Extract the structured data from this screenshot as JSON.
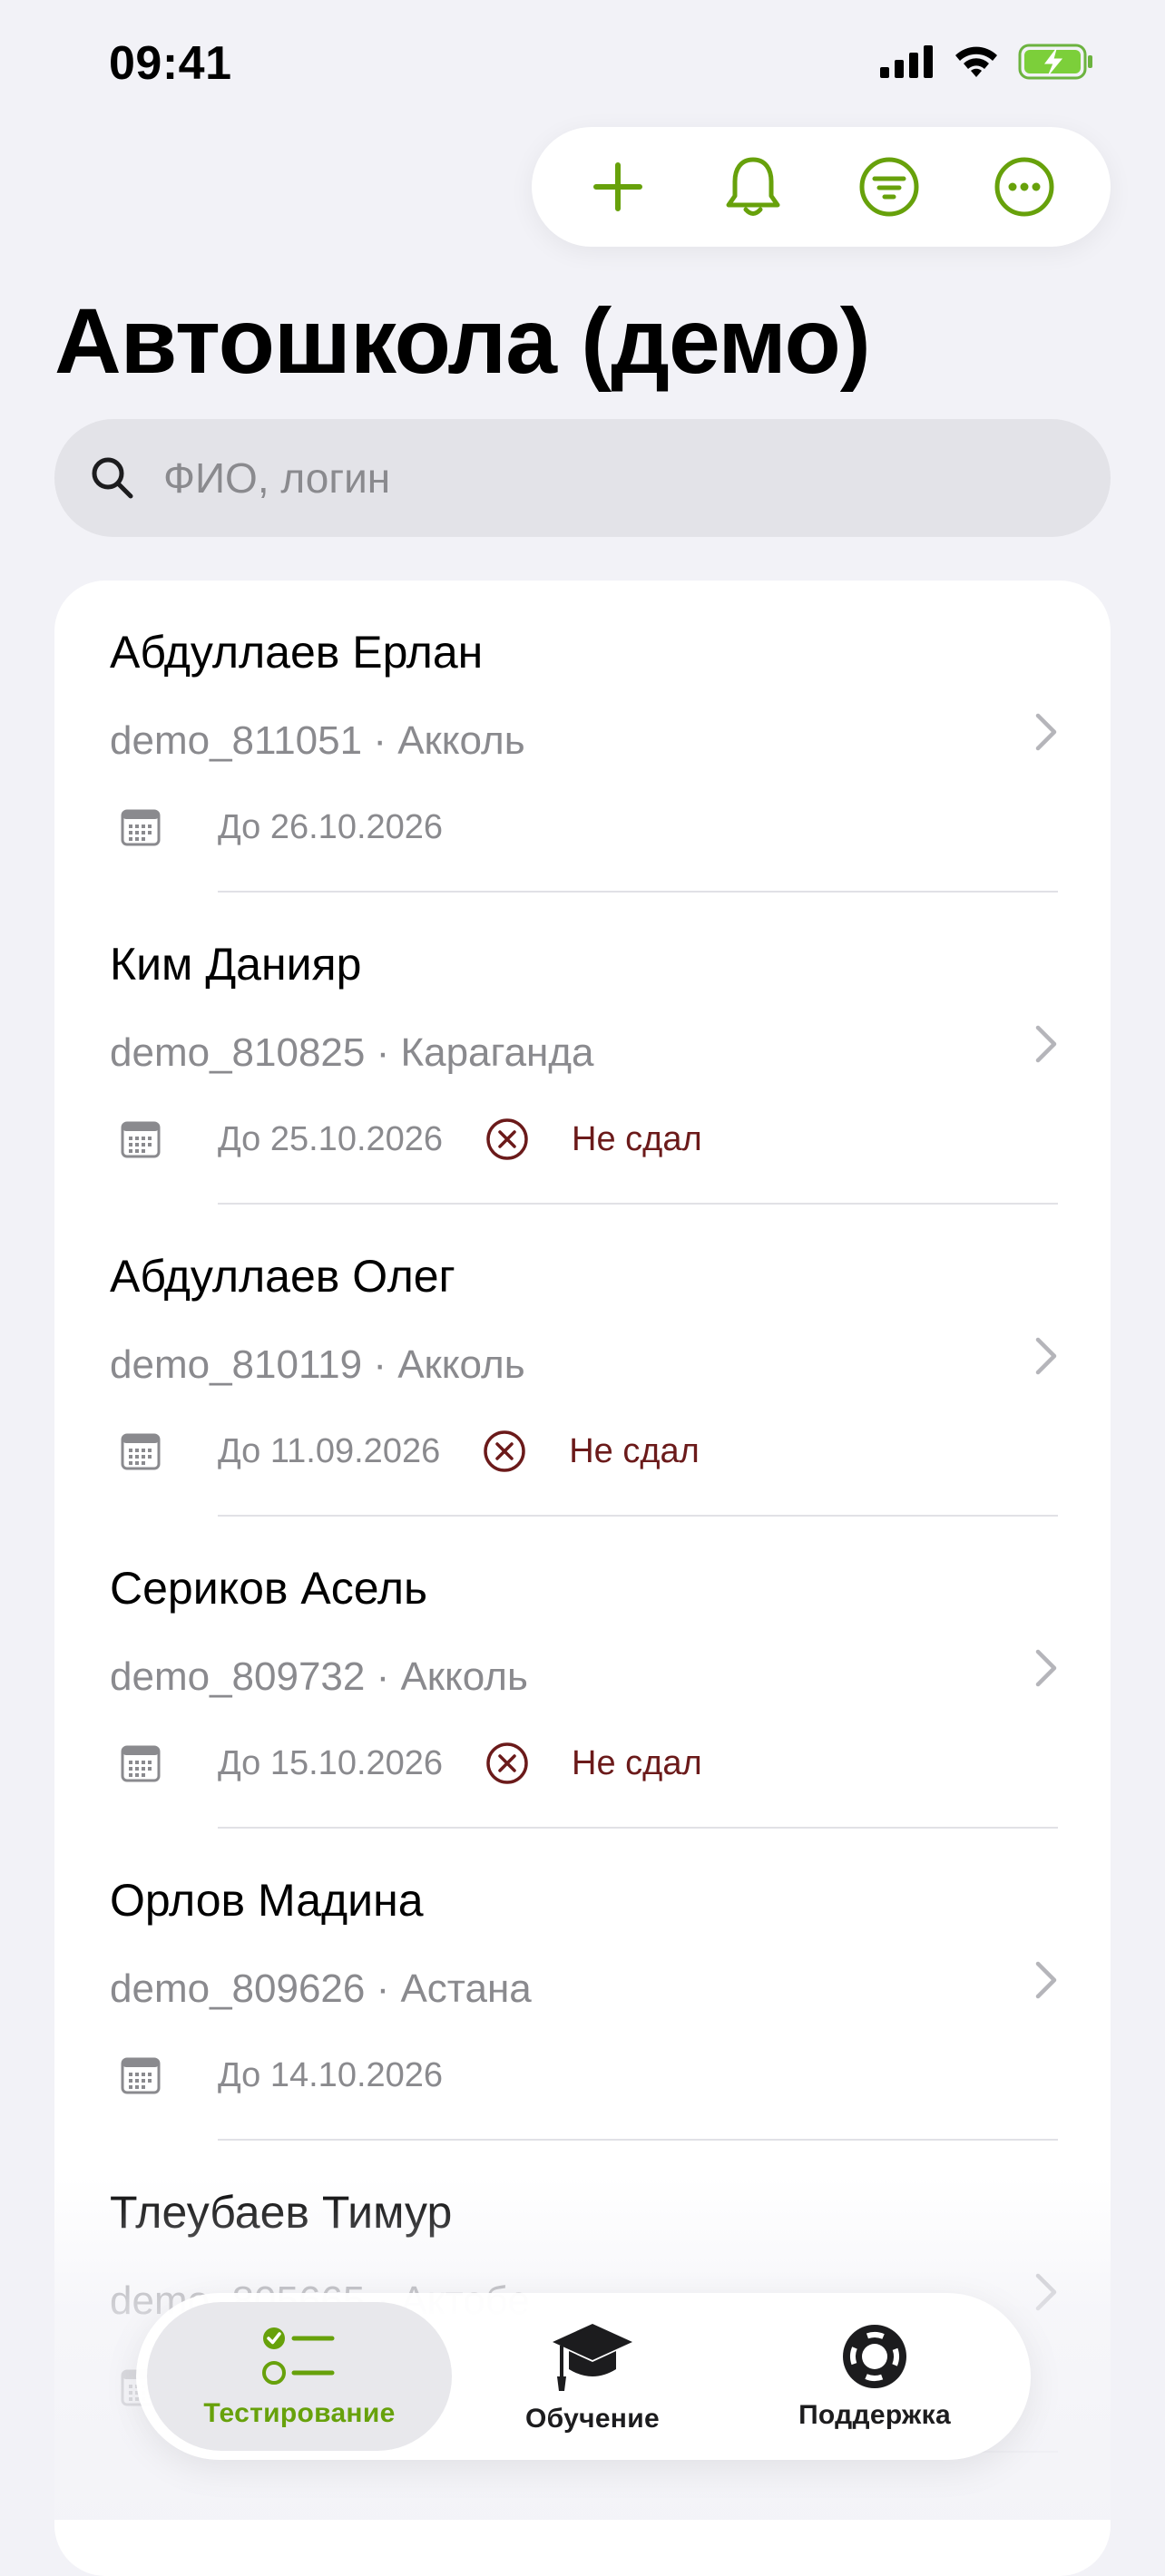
{
  "status_bar": {
    "time": "09:41"
  },
  "header": {
    "title": "Автошкола (демо)",
    "toolbar_icons": [
      "plus-icon",
      "bell-icon",
      "filter-icon",
      "more-icon"
    ]
  },
  "search": {
    "placeholder": "ФИО, логин",
    "value": ""
  },
  "students": [
    {
      "name": "Абдуллаев Ерлан",
      "login_city": "demo_811051 · Акколь",
      "date": "До 26.10.2026",
      "status": ""
    },
    {
      "name": "Ким Данияр",
      "login_city": "demo_810825 · Караганда",
      "date": "До 25.10.2026",
      "status": "Не сдал"
    },
    {
      "name": "Абдуллаев Олег",
      "login_city": "demo_810119 · Акколь",
      "date": "До 11.09.2026",
      "status": "Не сдал"
    },
    {
      "name": "Сериков Асель",
      "login_city": "demo_809732 · Акколь",
      "date": "До 15.10.2026",
      "status": "Не сдал"
    },
    {
      "name": "Орлов Мадина",
      "login_city": "demo_809626 · Астана",
      "date": "До 14.10.2026",
      "status": ""
    },
    {
      "name": "Тлеубаев Тимур",
      "login_city": "demo_805665 · Актобе",
      "date": "",
      "status": ""
    }
  ],
  "tabbar": {
    "tabs": [
      {
        "label": "Тестирование",
        "icon": "checklist-icon",
        "active": true
      },
      {
        "label": "Обучение",
        "icon": "graduation-cap-icon",
        "active": false
      },
      {
        "label": "Поддержка",
        "icon": "lifebuoy-icon",
        "active": false
      }
    ]
  },
  "colors": {
    "accent": "#67a10b",
    "fail": "#6b1a1a",
    "background": "#f2f2f7"
  }
}
